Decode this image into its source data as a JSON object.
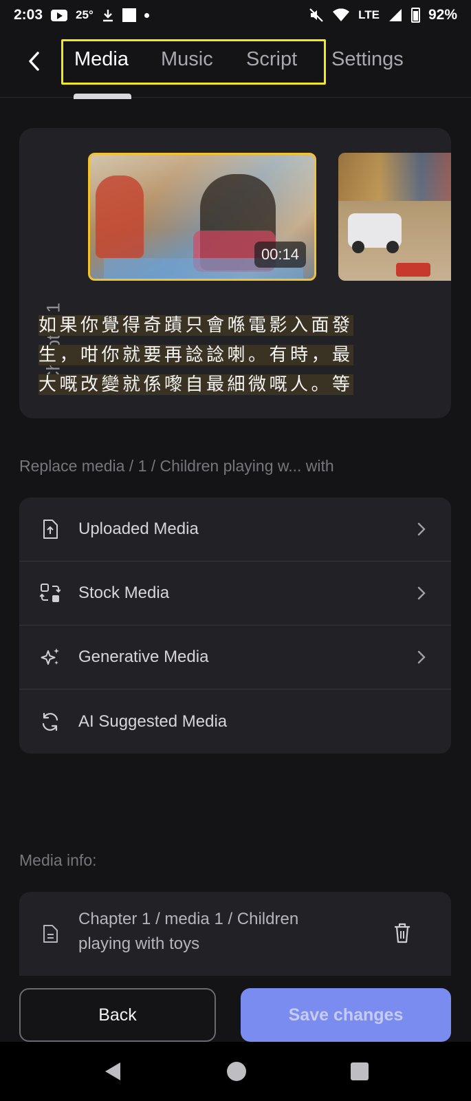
{
  "status_bar": {
    "time": "2:03",
    "temperature": "25°",
    "network_label": "LTE",
    "battery": "92%"
  },
  "nav": {
    "tabs": [
      {
        "label": "Media",
        "active": true
      },
      {
        "label": "Music",
        "active": false
      },
      {
        "label": "Script",
        "active": false
      },
      {
        "label": "Settings",
        "active": false
      }
    ],
    "highlight_color": "#f3e91a"
  },
  "chapter": {
    "label": "Chapter 1",
    "thumbnails": [
      {
        "duration": "00:14",
        "selected": true
      },
      {
        "duration": "",
        "selected": false
      }
    ],
    "script_lines": [
      "如果你覺得奇蹟只會喺電影入面發",
      "生，咁你就要再諗諗喇。有時，最",
      "大嘅改變就係嚟自最細微嘅人。等"
    ]
  },
  "replace": {
    "path_text": "Replace media / 1 / Children playing w... with",
    "options": [
      {
        "label": "Uploaded Media",
        "icon": "upload-file-icon",
        "has_chevron": true
      },
      {
        "label": "Stock Media",
        "icon": "swap-shapes-icon",
        "has_chevron": true
      },
      {
        "label": "Generative Media",
        "icon": "sparkles-icon",
        "has_chevron": true
      },
      {
        "label": "AI Suggested Media",
        "icon": "refresh-icon",
        "has_chevron": false
      }
    ]
  },
  "media_info": {
    "label": "Media info:",
    "text": "Chapter 1 / media 1 / Children playing with toys"
  },
  "actions": {
    "back_label": "Back",
    "save_label": "Save changes"
  },
  "colors": {
    "background": "#141416",
    "card": "#222226",
    "accent": "#7b8cf0",
    "selected_thumb_border": "#f2c230"
  }
}
